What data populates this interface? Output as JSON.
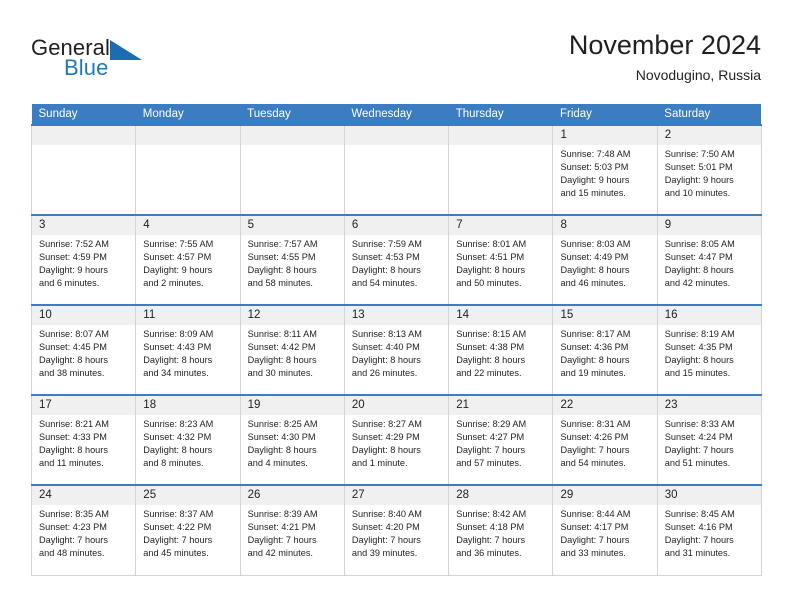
{
  "brand": {
    "name_part1": "General",
    "name_part2": "Blue",
    "flag_icon": "triangle-flag-icon"
  },
  "header": {
    "title": "November 2024",
    "subtitle": "Novodugino, Russia"
  },
  "colors": {
    "header_blue": "#3b7dc0",
    "brand_blue": "#1f77bd",
    "daynum_gray": "#f0f0f0",
    "text": "#231f20",
    "grid_line": "#d4d4d4"
  },
  "calendar": {
    "weekday_headers": [
      "Sunday",
      "Monday",
      "Tuesday",
      "Wednesday",
      "Thursday",
      "Friday",
      "Saturday"
    ],
    "weeks": [
      [
        {
          "day": "",
          "empty": true,
          "sunrise": "",
          "sunset": "",
          "daylight_line1": "",
          "daylight_line2": ""
        },
        {
          "day": "",
          "empty": true,
          "sunrise": "",
          "sunset": "",
          "daylight_line1": "",
          "daylight_line2": ""
        },
        {
          "day": "",
          "empty": true,
          "sunrise": "",
          "sunset": "",
          "daylight_line1": "",
          "daylight_line2": ""
        },
        {
          "day": "",
          "empty": true,
          "sunrise": "",
          "sunset": "",
          "daylight_line1": "",
          "daylight_line2": ""
        },
        {
          "day": "",
          "empty": true,
          "sunrise": "",
          "sunset": "",
          "daylight_line1": "",
          "daylight_line2": ""
        },
        {
          "day": "1",
          "empty": false,
          "sunrise": "Sunrise: 7:48 AM",
          "sunset": "Sunset: 5:03 PM",
          "daylight_line1": "Daylight: 9 hours",
          "daylight_line2": "and 15 minutes."
        },
        {
          "day": "2",
          "empty": false,
          "sunrise": "Sunrise: 7:50 AM",
          "sunset": "Sunset: 5:01 PM",
          "daylight_line1": "Daylight: 9 hours",
          "daylight_line2": "and 10 minutes."
        }
      ],
      [
        {
          "day": "3",
          "empty": false,
          "sunrise": "Sunrise: 7:52 AM",
          "sunset": "Sunset: 4:59 PM",
          "daylight_line1": "Daylight: 9 hours",
          "daylight_line2": "and 6 minutes."
        },
        {
          "day": "4",
          "empty": false,
          "sunrise": "Sunrise: 7:55 AM",
          "sunset": "Sunset: 4:57 PM",
          "daylight_line1": "Daylight: 9 hours",
          "daylight_line2": "and 2 minutes."
        },
        {
          "day": "5",
          "empty": false,
          "sunrise": "Sunrise: 7:57 AM",
          "sunset": "Sunset: 4:55 PM",
          "daylight_line1": "Daylight: 8 hours",
          "daylight_line2": "and 58 minutes."
        },
        {
          "day": "6",
          "empty": false,
          "sunrise": "Sunrise: 7:59 AM",
          "sunset": "Sunset: 4:53 PM",
          "daylight_line1": "Daylight: 8 hours",
          "daylight_line2": "and 54 minutes."
        },
        {
          "day": "7",
          "empty": false,
          "sunrise": "Sunrise: 8:01 AM",
          "sunset": "Sunset: 4:51 PM",
          "daylight_line1": "Daylight: 8 hours",
          "daylight_line2": "and 50 minutes."
        },
        {
          "day": "8",
          "empty": false,
          "sunrise": "Sunrise: 8:03 AM",
          "sunset": "Sunset: 4:49 PM",
          "daylight_line1": "Daylight: 8 hours",
          "daylight_line2": "and 46 minutes."
        },
        {
          "day": "9",
          "empty": false,
          "sunrise": "Sunrise: 8:05 AM",
          "sunset": "Sunset: 4:47 PM",
          "daylight_line1": "Daylight: 8 hours",
          "daylight_line2": "and 42 minutes."
        }
      ],
      [
        {
          "day": "10",
          "empty": false,
          "sunrise": "Sunrise: 8:07 AM",
          "sunset": "Sunset: 4:45 PM",
          "daylight_line1": "Daylight: 8 hours",
          "daylight_line2": "and 38 minutes."
        },
        {
          "day": "11",
          "empty": false,
          "sunrise": "Sunrise: 8:09 AM",
          "sunset": "Sunset: 4:43 PM",
          "daylight_line1": "Daylight: 8 hours",
          "daylight_line2": "and 34 minutes."
        },
        {
          "day": "12",
          "empty": false,
          "sunrise": "Sunrise: 8:11 AM",
          "sunset": "Sunset: 4:42 PM",
          "daylight_line1": "Daylight: 8 hours",
          "daylight_line2": "and 30 minutes."
        },
        {
          "day": "13",
          "empty": false,
          "sunrise": "Sunrise: 8:13 AM",
          "sunset": "Sunset: 4:40 PM",
          "daylight_line1": "Daylight: 8 hours",
          "daylight_line2": "and 26 minutes."
        },
        {
          "day": "14",
          "empty": false,
          "sunrise": "Sunrise: 8:15 AM",
          "sunset": "Sunset: 4:38 PM",
          "daylight_line1": "Daylight: 8 hours",
          "daylight_line2": "and 22 minutes."
        },
        {
          "day": "15",
          "empty": false,
          "sunrise": "Sunrise: 8:17 AM",
          "sunset": "Sunset: 4:36 PM",
          "daylight_line1": "Daylight: 8 hours",
          "daylight_line2": "and 19 minutes."
        },
        {
          "day": "16",
          "empty": false,
          "sunrise": "Sunrise: 8:19 AM",
          "sunset": "Sunset: 4:35 PM",
          "daylight_line1": "Daylight: 8 hours",
          "daylight_line2": "and 15 minutes."
        }
      ],
      [
        {
          "day": "17",
          "empty": false,
          "sunrise": "Sunrise: 8:21 AM",
          "sunset": "Sunset: 4:33 PM",
          "daylight_line1": "Daylight: 8 hours",
          "daylight_line2": "and 11 minutes."
        },
        {
          "day": "18",
          "empty": false,
          "sunrise": "Sunrise: 8:23 AM",
          "sunset": "Sunset: 4:32 PM",
          "daylight_line1": "Daylight: 8 hours",
          "daylight_line2": "and 8 minutes."
        },
        {
          "day": "19",
          "empty": false,
          "sunrise": "Sunrise: 8:25 AM",
          "sunset": "Sunset: 4:30 PM",
          "daylight_line1": "Daylight: 8 hours",
          "daylight_line2": "and 4 minutes."
        },
        {
          "day": "20",
          "empty": false,
          "sunrise": "Sunrise: 8:27 AM",
          "sunset": "Sunset: 4:29 PM",
          "daylight_line1": "Daylight: 8 hours",
          "daylight_line2": "and 1 minute."
        },
        {
          "day": "21",
          "empty": false,
          "sunrise": "Sunrise: 8:29 AM",
          "sunset": "Sunset: 4:27 PM",
          "daylight_line1": "Daylight: 7 hours",
          "daylight_line2": "and 57 minutes."
        },
        {
          "day": "22",
          "empty": false,
          "sunrise": "Sunrise: 8:31 AM",
          "sunset": "Sunset: 4:26 PM",
          "daylight_line1": "Daylight: 7 hours",
          "daylight_line2": "and 54 minutes."
        },
        {
          "day": "23",
          "empty": false,
          "sunrise": "Sunrise: 8:33 AM",
          "sunset": "Sunset: 4:24 PM",
          "daylight_line1": "Daylight: 7 hours",
          "daylight_line2": "and 51 minutes."
        }
      ],
      [
        {
          "day": "24",
          "empty": false,
          "sunrise": "Sunrise: 8:35 AM",
          "sunset": "Sunset: 4:23 PM",
          "daylight_line1": "Daylight: 7 hours",
          "daylight_line2": "and 48 minutes."
        },
        {
          "day": "25",
          "empty": false,
          "sunrise": "Sunrise: 8:37 AM",
          "sunset": "Sunset: 4:22 PM",
          "daylight_line1": "Daylight: 7 hours",
          "daylight_line2": "and 45 minutes."
        },
        {
          "day": "26",
          "empty": false,
          "sunrise": "Sunrise: 8:39 AM",
          "sunset": "Sunset: 4:21 PM",
          "daylight_line1": "Daylight: 7 hours",
          "daylight_line2": "and 42 minutes."
        },
        {
          "day": "27",
          "empty": false,
          "sunrise": "Sunrise: 8:40 AM",
          "sunset": "Sunset: 4:20 PM",
          "daylight_line1": "Daylight: 7 hours",
          "daylight_line2": "and 39 minutes."
        },
        {
          "day": "28",
          "empty": false,
          "sunrise": "Sunrise: 8:42 AM",
          "sunset": "Sunset: 4:18 PM",
          "daylight_line1": "Daylight: 7 hours",
          "daylight_line2": "and 36 minutes."
        },
        {
          "day": "29",
          "empty": false,
          "sunrise": "Sunrise: 8:44 AM",
          "sunset": "Sunset: 4:17 PM",
          "daylight_line1": "Daylight: 7 hours",
          "daylight_line2": "and 33 minutes."
        },
        {
          "day": "30",
          "empty": false,
          "sunrise": "Sunrise: 8:45 AM",
          "sunset": "Sunset: 4:16 PM",
          "daylight_line1": "Daylight: 7 hours",
          "daylight_line2": "and 31 minutes."
        }
      ]
    ]
  }
}
